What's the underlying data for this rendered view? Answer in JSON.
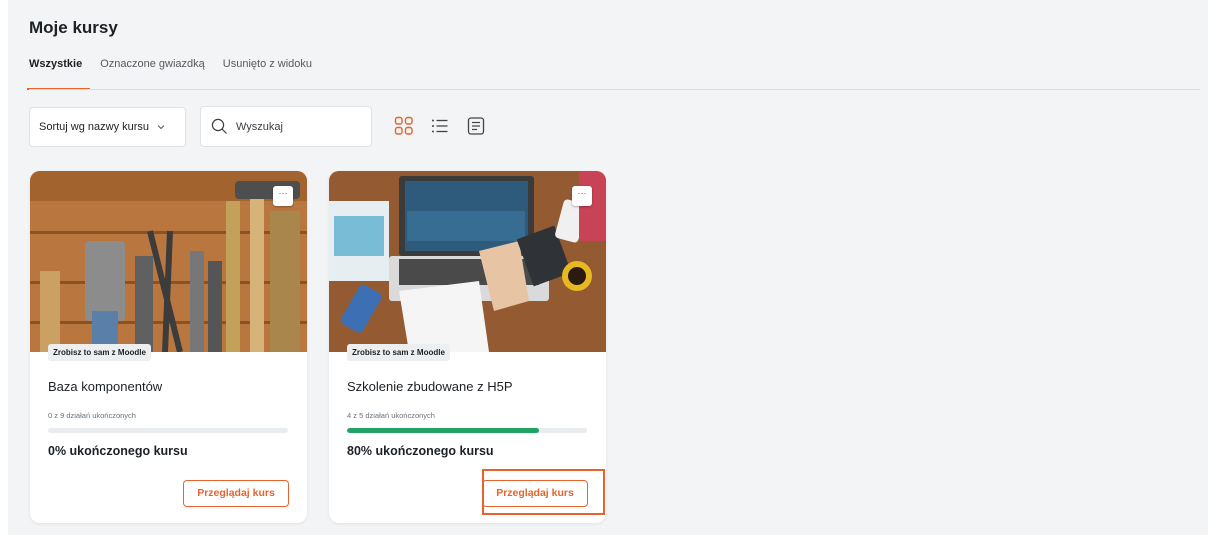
{
  "page": {
    "title": "Moje kursy"
  },
  "tabs": [
    {
      "label": "Wszystkie",
      "active": true
    },
    {
      "label": "Oznaczone gwiazdką",
      "active": false
    },
    {
      "label": "Usunięto z widoku",
      "active": false
    }
  ],
  "controls": {
    "sort_label": "Sortuj wg nazwy kursu",
    "search_placeholder": "Wyszukaj",
    "views": [
      {
        "icon": "grid-view-icon",
        "active": true
      },
      {
        "icon": "list-view-icon",
        "active": false
      },
      {
        "icon": "summary-view-icon",
        "active": false
      }
    ]
  },
  "courses": [
    {
      "image": "tools-image",
      "category": "Zrobisz to sam z Moodle",
      "name": "Baza komponentów",
      "activities": "0 z 9 działań ukończonych",
      "progress": 0,
      "percent_label": "0% ukończonego kursu",
      "button": "Przeglądaj kurs",
      "menu": "···"
    },
    {
      "image": "laptop-desk-image",
      "category": "Zrobisz to sam z Moodle",
      "name": "Szkolenie zbudowane z H5P",
      "activities": "4 z 5 działań ukończonych",
      "progress": 80,
      "percent_label": "80% ukończonego kursu",
      "button": "Przeglądaj kurs",
      "menu": "···"
    }
  ],
  "colors": {
    "accent": "#e8632c",
    "progress": "#21a366",
    "background": "#f3f4f5"
  }
}
